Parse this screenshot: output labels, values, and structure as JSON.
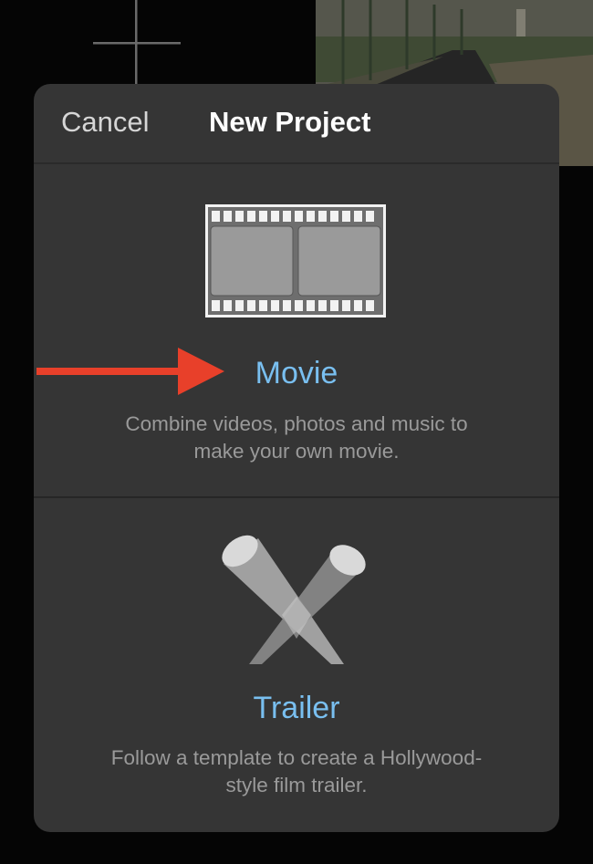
{
  "header": {
    "cancel_label": "Cancel",
    "title": "New Project"
  },
  "options": [
    {
      "label": "Movie",
      "description": "Combine videos, photos and music to make your own movie.",
      "icon": "film-strip-icon"
    },
    {
      "label": "Trailer",
      "description": "Follow a template to create a Hollywood-style film trailer.",
      "icon": "spotlights-icon"
    }
  ],
  "annotation": {
    "icon": "red-arrow-icon",
    "color": "#e8402a"
  },
  "colors": {
    "sheet_background": "#353535",
    "accent_label": "#79bff0",
    "description_text": "#9a9a9a"
  }
}
